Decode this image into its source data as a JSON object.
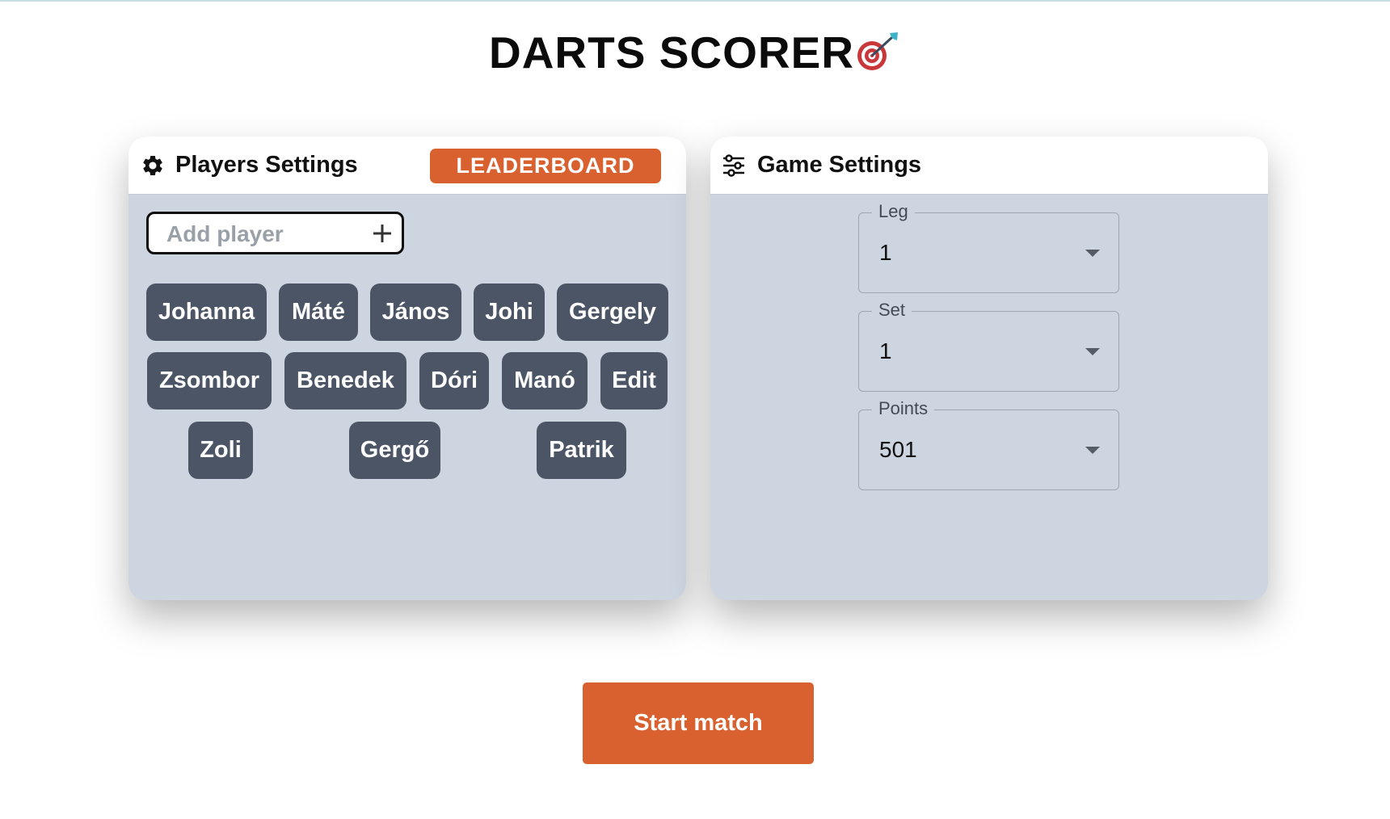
{
  "app": {
    "title": "DARTS SCORER",
    "title_icon": "dart-target-icon"
  },
  "players_panel": {
    "title": "Players Settings",
    "icon": "gear-icon",
    "leaderboard_label": "LEADERBOARD",
    "add_player_placeholder": "Add player",
    "add_icon": "plus-icon",
    "players": [
      "Johanna",
      "Máté",
      "János",
      "Johi",
      "Gergely",
      "Zsombor",
      "Benedek",
      "Dóri",
      "Manó",
      "Edit",
      "Zoli",
      "Gergő",
      "Patrik"
    ]
  },
  "game_panel": {
    "title": "Game Settings",
    "icon": "sliders-icon",
    "fields": [
      {
        "label": "Leg",
        "value": "1"
      },
      {
        "label": "Set",
        "value": "1"
      },
      {
        "label": "Points",
        "value": "501"
      }
    ]
  },
  "start_label": "Start match",
  "colors": {
    "accent": "#d9612f",
    "chip": "#4b5565",
    "panel_bg": "#ccd5e0"
  }
}
